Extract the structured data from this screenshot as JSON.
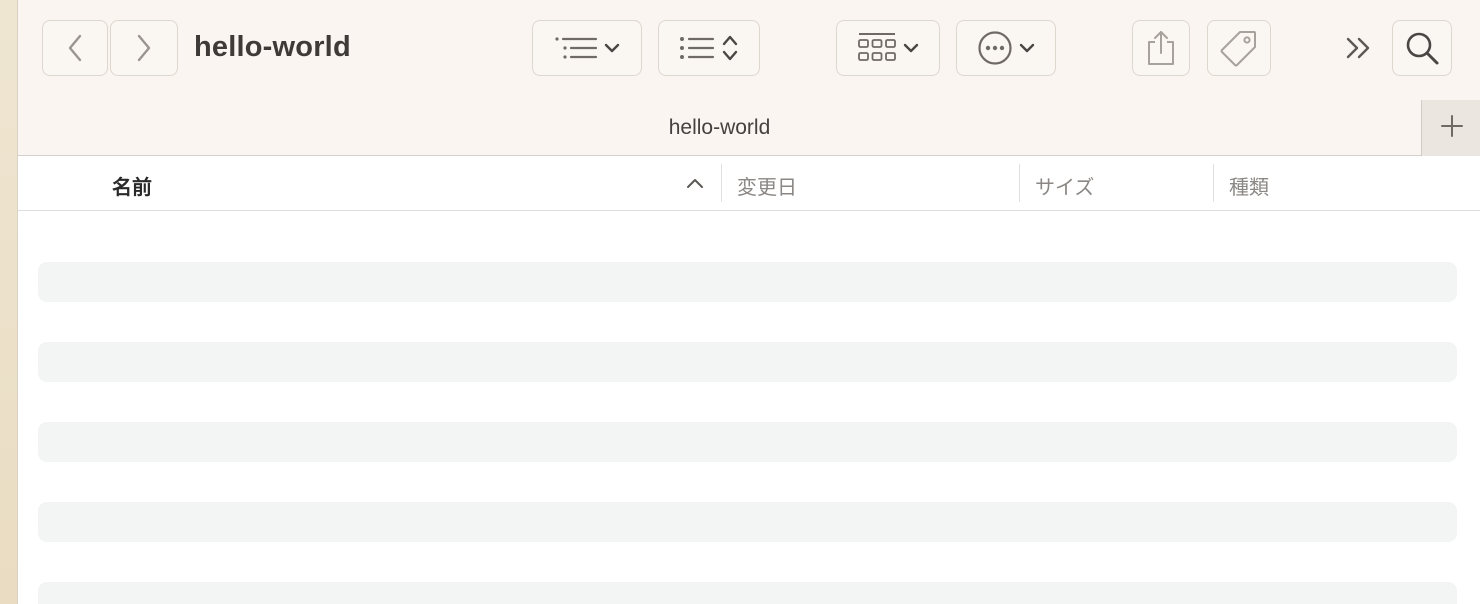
{
  "window": {
    "title": "hello-world",
    "tab_title": "hello-world"
  },
  "toolbar": {
    "back_icon": "chevron-left-icon",
    "forward_icon": "chevron-right-icon",
    "group_icon": "list-indent-icon",
    "sort_icon": "list-bullets-icon",
    "view_icon": "grid-view-icon",
    "action_icon": "ellipsis-circle-icon",
    "share_icon": "share-icon",
    "tag_icon": "tag-icon",
    "overflow_icon": "double-chevron-right-icon",
    "search_icon": "magnifier-icon"
  },
  "table": {
    "columns": [
      {
        "label": "名前",
        "sorted": true,
        "sort_direction": "ascending"
      },
      {
        "label": "変更日"
      },
      {
        "label": "サイズ"
      },
      {
        "label": "種類"
      }
    ],
    "rows": []
  },
  "colors": {
    "toolbar_bg": "#faf5f0",
    "stripe": "#f3f4f4",
    "desktop": "#ece3cf"
  }
}
